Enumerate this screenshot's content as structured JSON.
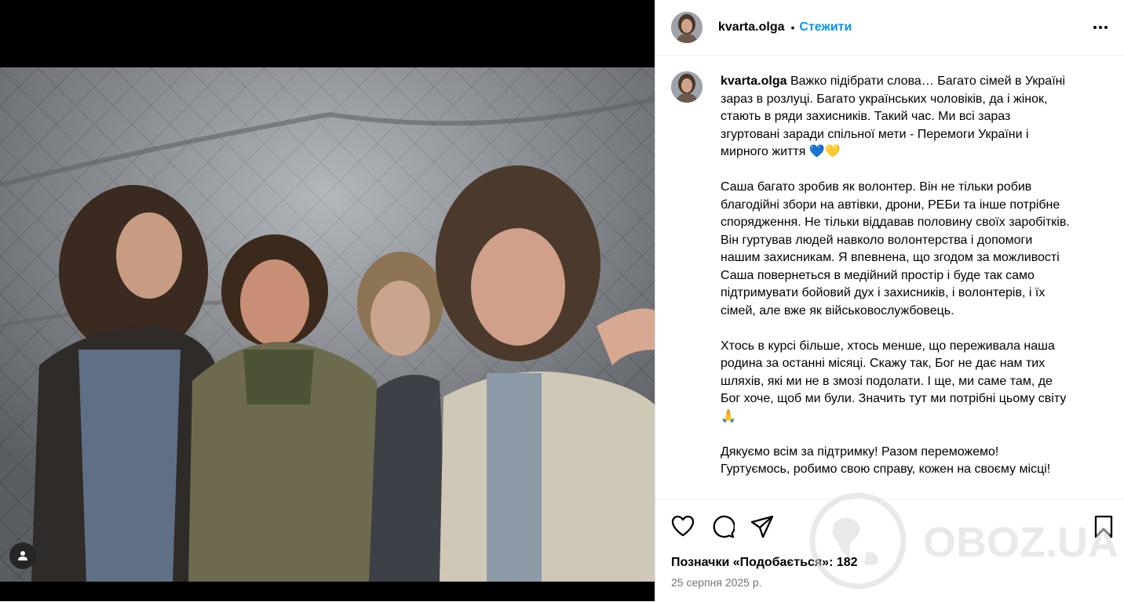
{
  "post": {
    "username": "kvarta.olga",
    "follow_label": "Стежити",
    "separator": "•",
    "caption_paragraphs": [
      [
        "Важко підібрати слова… Багато сімей в Україні",
        "зараз в розлуці. Багато українських чоловіків, да і жінок,",
        "стають в ряди захисників. Такий час. Ми всі зараз",
        "згуртовані заради спільної мети - Перемоги України і",
        "мирного життя 💙💛"
      ],
      [
        "Саша багато зробив як волонтер. Він не тільки робив",
        "благодійні збори на автівки, дрони, РЕБи та інше потрібне",
        "спорядження. Не тільки віддавав половину своїх заробітків.",
        "Він гуртував людей навколо волонтерства і допомоги",
        "нашим захисникам. Я впевнена, що згодом за можливості",
        "Саша повернеться в медійний простір і буде так само",
        "підтримувати бойовий дух і захисників, і волонтерів, і їх",
        "сімей, але вже як військовослужбовець."
      ],
      [
        "Хтось в курсі більше, хтось менше, що переживала наша",
        "родина за останні місяці. Скажу так, Бог не дає нам тих",
        "шляхів, які ми не в змозі подолати. І ще, ми саме там, де",
        "Бог хоче, щоб ми були. Значить тут ми потрібні цьому світу",
        "🙏"
      ],
      [
        "Дякуємо всім за підтримку! Разом переможемо!",
        "Гуртуємось, робимо свою справу, кожен на своєму місці!"
      ]
    ],
    "likes_label": "Позначки «Подобається»: 182",
    "date": "25 серпня 2025 р."
  },
  "watermark": {
    "text": "OBOZ.UA"
  },
  "icons": {
    "more": "more-options-icon",
    "like": "heart-icon",
    "comment": "comment-icon",
    "share": "share-icon",
    "save": "bookmark-icon",
    "tagged": "user-tag-icon"
  }
}
